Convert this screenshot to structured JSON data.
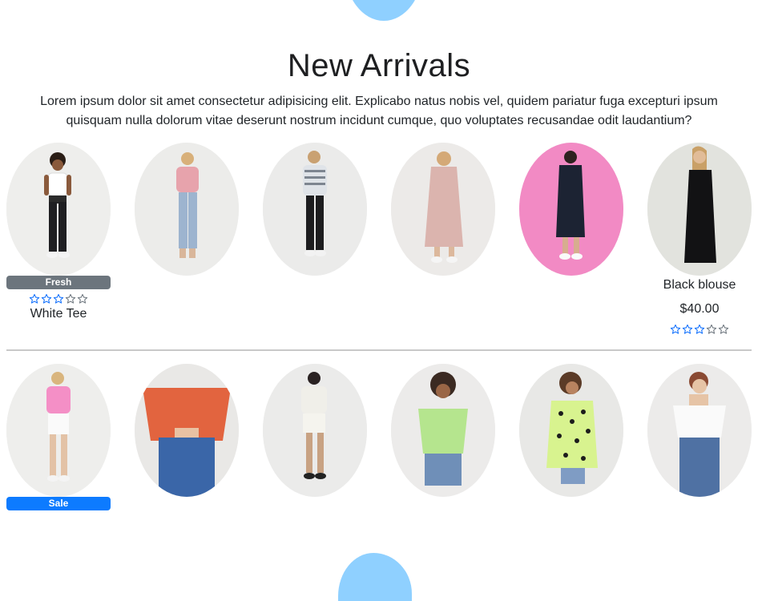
{
  "section": {
    "title": "New Arrivals",
    "description": "Lorem ipsum dolor sit amet consectetur adipisicing elit. Explicabo natus nobis vel, quidem pariatur fuga excepturi ipsum quisquam nulla dolorum vitae deserunt nostrum incidunt cumque, quo voluptates recusandae odit laudantium?"
  },
  "colors": {
    "accent_blob": "#8fd0ff",
    "badge_fresh": "#6c757d",
    "badge_sale": "#0d7bff",
    "star": "#0d6efd"
  },
  "rows": [
    {
      "products": [
        {
          "image": "woman-white-tee-black-jeans",
          "badge": "Fresh",
          "rating": 3,
          "name": "White Tee",
          "price": ""
        },
        {
          "image": "woman-pink-top-blue-jeans",
          "badge": "",
          "rating": 0,
          "name": "",
          "price": ""
        },
        {
          "image": "woman-striped-shirt-black-leggings",
          "badge": "",
          "rating": 0,
          "name": "",
          "price": ""
        },
        {
          "image": "woman-pink-midi-dress",
          "badge": "",
          "rating": 0,
          "name": "",
          "price": ""
        },
        {
          "image": "woman-navy-dress-pink-background",
          "badge": "",
          "rating": 0,
          "name": "",
          "price": ""
        },
        {
          "image": "woman-black-slip-dress",
          "badge": "",
          "rating": 3,
          "name": "Black blouse",
          "price": "$40.00"
        }
      ]
    },
    {
      "products": [
        {
          "image": "woman-pink-shirt-white-shorts",
          "badge": "Sale",
          "rating": 0,
          "name": "",
          "price": ""
        },
        {
          "image": "woman-orange-ruched-top",
          "badge": "",
          "rating": 0,
          "name": "",
          "price": ""
        },
        {
          "image": "woman-white-shirt-mini-skirt",
          "badge": "",
          "rating": 0,
          "name": "",
          "price": ""
        },
        {
          "image": "woman-green-blouse-denim-shorts",
          "badge": "",
          "rating": 0,
          "name": "",
          "price": ""
        },
        {
          "image": "woman-polka-dot-shirt",
          "badge": "",
          "rating": 0,
          "name": "",
          "price": ""
        },
        {
          "image": "woman-white-offshoulder-top",
          "badge": "",
          "rating": 0,
          "name": "",
          "price": ""
        }
      ]
    }
  ]
}
